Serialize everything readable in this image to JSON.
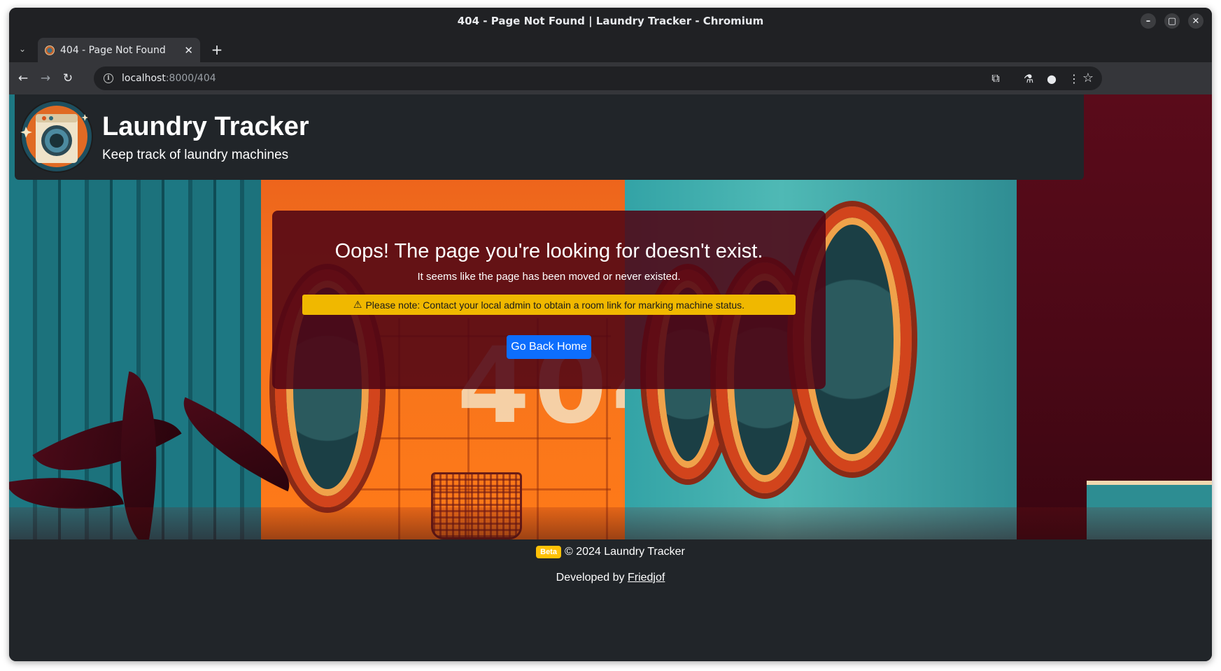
{
  "window": {
    "title": "404 - Page Not Found | Laundry Tracker - Chromium",
    "controls": {
      "minimize": "–",
      "maximize": "▢",
      "close": "✕"
    }
  },
  "tabs": [
    {
      "title": "404 - Page Not Found",
      "active": true
    }
  ],
  "toolbar": {
    "url_host": "localhost",
    "url_path": ":8000/404"
  },
  "header": {
    "title": "Laundry Tracker",
    "subtitle": "Keep track of laundry machines"
  },
  "card": {
    "heading": "Oops! The page you're looking for doesn't exist.",
    "text": "It seems like the page has been moved or never existed.",
    "alert": "Please note: Contact your local admin to obtain a room link for marking machine status.",
    "button": "Go Back Home"
  },
  "footer": {
    "badge": "Beta",
    "copyright": "© 2024 Laundry Tracker",
    "developed_by": "Developed by ",
    "author": "Friedjof"
  },
  "colors": {
    "header_bg": "#212529",
    "button": "#0d6efd",
    "alert": "#f0b800",
    "badge": "#ffc107",
    "card_bg": "#500514"
  },
  "background_text": "404"
}
